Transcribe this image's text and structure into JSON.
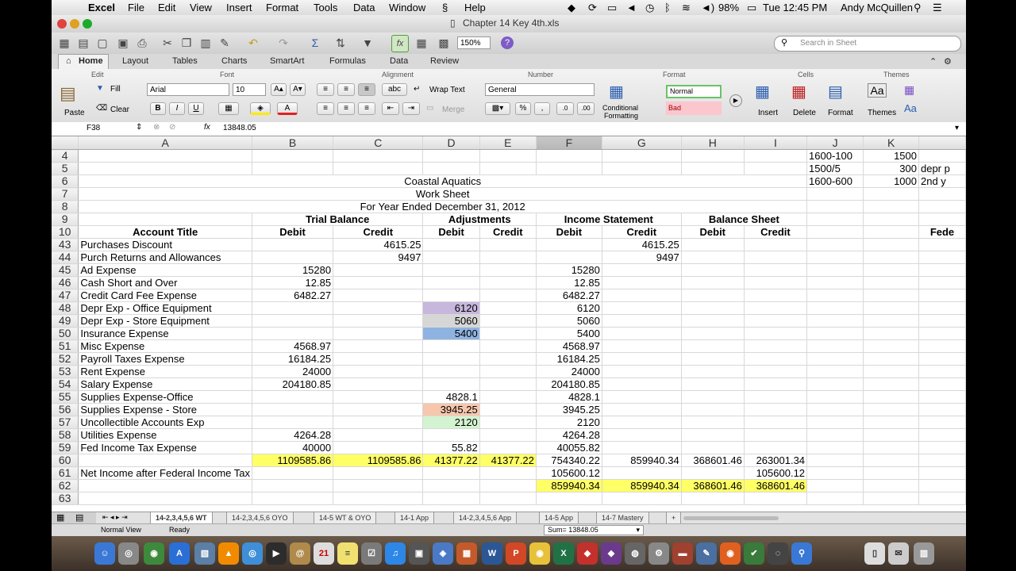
{
  "menubar": {
    "app": "Excel",
    "items": [
      "File",
      "Edit",
      "View",
      "Insert",
      "Format",
      "Tools",
      "Data",
      "Window",
      "Help"
    ],
    "battery": "98%",
    "clock": "Tue 12:45 PM",
    "user": "Andy McQuillen"
  },
  "window": {
    "title": "Chapter 14 Key 4th.xls"
  },
  "toolbar": {
    "zoom": "150%",
    "search_placeholder": "Search in Sheet"
  },
  "ribbon": {
    "tabs": [
      "Home",
      "Layout",
      "Tables",
      "Charts",
      "SmartArt",
      "Formulas",
      "Data",
      "Review"
    ],
    "groups": {
      "edit": "Edit",
      "font": "Font",
      "alignment": "Alignment",
      "number": "Number",
      "format": "Format",
      "cells": "Cells",
      "themes": "Themes"
    },
    "fill": "Fill",
    "clear": "Clear",
    "paste": "Paste",
    "font_name": "Arial",
    "font_size": "10",
    "wrap_text": "Wrap Text",
    "merge": "Merge",
    "number_format": "General",
    "conditional": "Conditional",
    "formatting": "Formatting",
    "style_normal": "Normal",
    "style_bad": "Bad",
    "insert": "Insert",
    "delete": "Delete",
    "format": "Format",
    "themes": "Themes"
  },
  "formula_bar": {
    "cell": "F38",
    "value": "13848.05"
  },
  "columns": [
    "A",
    "B",
    "C",
    "D",
    "E",
    "F",
    "G",
    "H",
    "I",
    "J",
    "K"
  ],
  "selected_column": "F",
  "highlight_colors": {
    "yellow": "#ffff66",
    "purple": "#c7b7dd",
    "gray": "#d6d6d6",
    "blue": "#8fb3e0",
    "peach": "#f6c7ad",
    "green": "#d4f3d0"
  },
  "rows": [
    {
      "n": "4",
      "J": "1600-100",
      "K": "1500"
    },
    {
      "n": "5",
      "J": "1500/5",
      "K": "300",
      "L": "depr p"
    },
    {
      "n": "6",
      "title": "Coastal Aquatics",
      "J": "1600-600",
      "K": "1000",
      "L": "2nd y"
    },
    {
      "n": "7",
      "title": "Work Sheet"
    },
    {
      "n": "8",
      "title": "For Year Ended December 31, 2012"
    },
    {
      "n": "9",
      "hdr1": [
        "Trial Balance",
        "Adjustments",
        "Income Statement",
        "Balance Sheet"
      ]
    },
    {
      "n": "10",
      "A": "Account Title",
      "B": "Debit",
      "C": "Credit",
      "D": "Debit",
      "E": "Credit",
      "F": "Debit",
      "G": "Credit",
      "H": "Debit",
      "I": "Credit",
      "L": "Fede"
    },
    {
      "n": "43",
      "A": "Purchases Discount",
      "C": "4615.25",
      "G": "4615.25"
    },
    {
      "n": "44",
      "A": "Purch Returns and Allowances",
      "C": "9497",
      "G": "9497"
    },
    {
      "n": "45",
      "A": "Ad Expense",
      "B": "15280",
      "F": "15280"
    },
    {
      "n": "46",
      "A": "Cash Short and Over",
      "B": "12.85",
      "F": "12.85"
    },
    {
      "n": "47",
      "A": "Credit Card Fee Expense",
      "B": "6482.27",
      "F": "6482.27"
    },
    {
      "n": "48",
      "A": "Depr Exp - Office Equipment",
      "D": "6120",
      "F": "6120",
      "Dc": "purple"
    },
    {
      "n": "49",
      "A": "Depr Exp - Store Equipment",
      "D": "5060",
      "F": "5060",
      "Dc": "gray"
    },
    {
      "n": "50",
      "A": "Insurance Expense",
      "D": "5400",
      "F": "5400",
      "Dc": "blue"
    },
    {
      "n": "51",
      "A": "Misc Expense",
      "B": "4568.97",
      "F": "4568.97"
    },
    {
      "n": "52",
      "A": "Payroll Taxes Expense",
      "B": "16184.25",
      "F": "16184.25"
    },
    {
      "n": "53",
      "A": "Rent Expense",
      "B": "24000",
      "F": "24000"
    },
    {
      "n": "54",
      "A": "Salary Expense",
      "B": "204180.85",
      "F": "204180.85"
    },
    {
      "n": "55",
      "A": "Supplies Expense-Office",
      "D": "4828.1",
      "F": "4828.1",
      "Dc": "yellow"
    },
    {
      "n": "56",
      "A": "Supplies Expense - Store",
      "D": "3945.25",
      "F": "3945.25",
      "Dc": "peach"
    },
    {
      "n": "57",
      "A": "Uncollectible Accounts Exp",
      "D": "2120",
      "F": "2120",
      "Dc": "green"
    },
    {
      "n": "58",
      "A": "Utilities Expense",
      "B": "4264.28",
      "F": "4264.28"
    },
    {
      "n": "59",
      "A": "Fed Income Tax Expense",
      "B": "40000",
      "D": "55.82",
      "F": "40055.82"
    },
    {
      "n": "60",
      "B": "1109585.86",
      "C": "1109585.86",
      "D": "41377.22",
      "E": "41377.22",
      "F": "754340.22",
      "G": "859940.34",
      "H": "368601.46",
      "I": "263001.34",
      "yellowBE": true
    },
    {
      "n": "61",
      "A": "Net Income after Federal Income Tax",
      "F": "105600.12",
      "I": "105600.12"
    },
    {
      "n": "62",
      "F": "859940.34",
      "G": "859940.34",
      "H": "368601.46",
      "I": "368601.46",
      "yellowFI": true
    },
    {
      "n": "63"
    }
  ],
  "sheet_tabs": [
    "14-2,3,4,5,6 WT",
    "14-2,3,4,5,6 OYO",
    "14-5 WT & OYO",
    "14-1 App",
    "14-2,3,4,5,6 App",
    "14-5 App",
    "14-7 Mastery",
    "+"
  ],
  "status": {
    "view": "Normal View",
    "ready": "Ready",
    "sum": "Sum= 13848.05"
  }
}
